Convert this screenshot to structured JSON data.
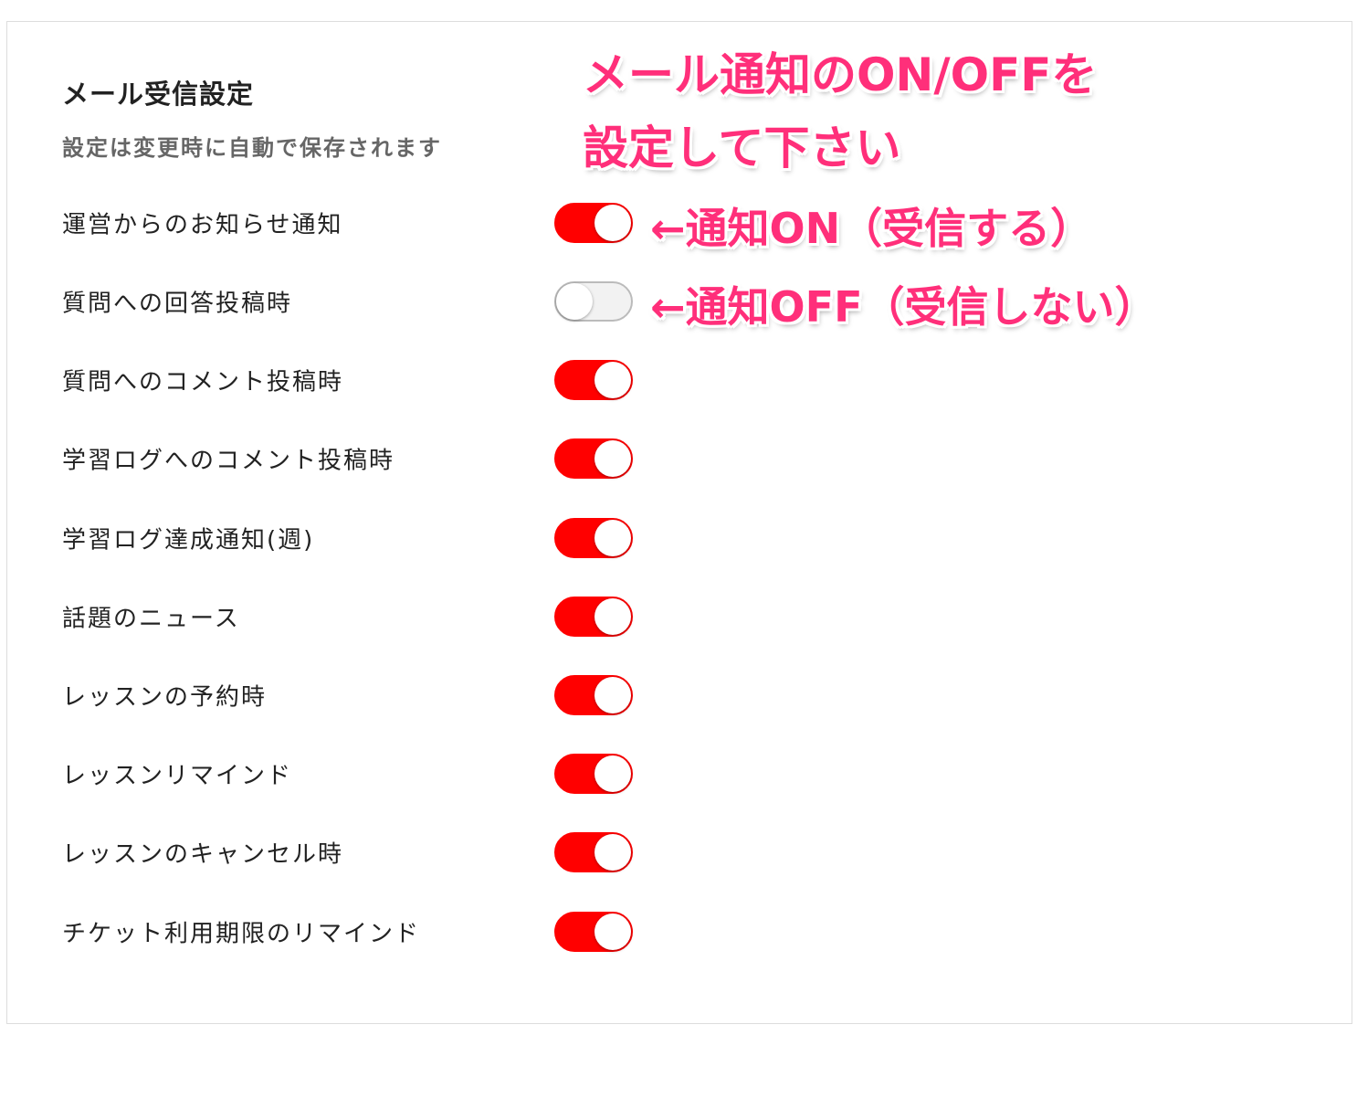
{
  "section": {
    "title": "メール受信設定",
    "subtitle": "設定は変更時に自動で保存されます"
  },
  "settings": [
    {
      "label": "運営からのお知らせ通知",
      "enabled": true
    },
    {
      "label": "質問への回答投稿時",
      "enabled": false
    },
    {
      "label": "質問へのコメント投稿時",
      "enabled": true
    },
    {
      "label": "学習ログへのコメント投稿時",
      "enabled": true
    },
    {
      "label": "学習ログ達成通知(週)",
      "enabled": true
    },
    {
      "label": "話題のニュース",
      "enabled": true
    },
    {
      "label": "レッスンの予約時",
      "enabled": true
    },
    {
      "label": "レッスンリマインド",
      "enabled": true
    },
    {
      "label": "レッスンのキャンセル時",
      "enabled": true
    },
    {
      "label": "チケット利用期限のリマインド",
      "enabled": true
    }
  ],
  "annotations": {
    "header_line1": "メール通知のON/OFFを",
    "header_line2": "設定して下さい",
    "on_hint": "←通知ON（受信する）",
    "off_hint": "←通知OFF（受信しない）"
  },
  "colors": {
    "toggle_on": "#ff0000",
    "toggle_off": "#f2f2f2",
    "annotation": "#ff2f7a"
  }
}
